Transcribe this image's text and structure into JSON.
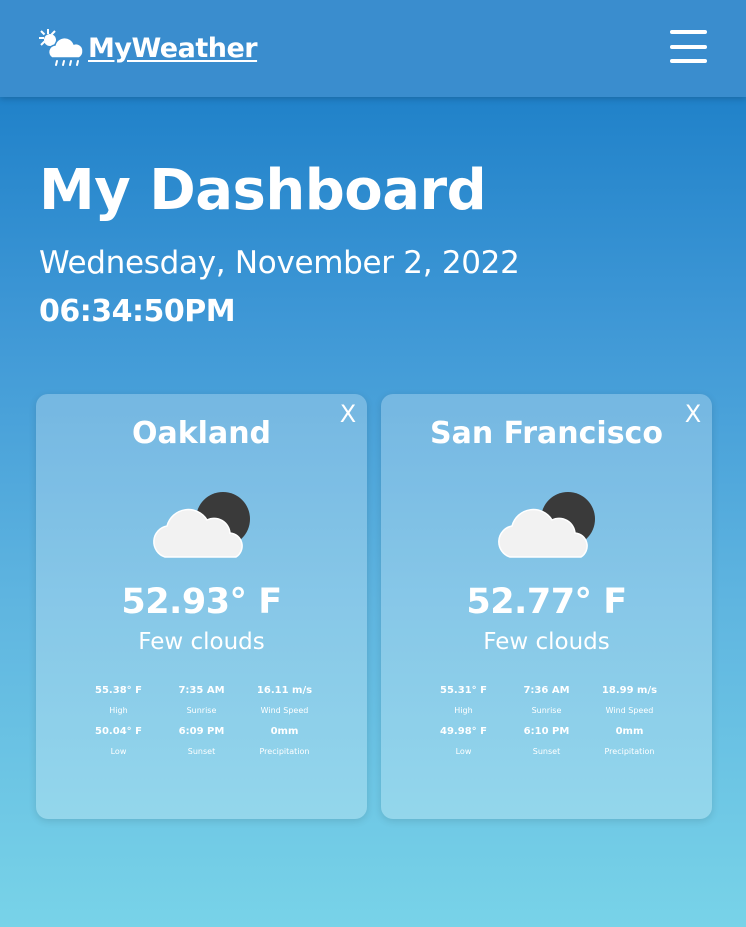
{
  "navbar": {
    "brand": "MyWeather",
    "logo_icon": "sun-cloud-rain-icon",
    "menu_icon": "hamburger-menu-icon"
  },
  "dashboard": {
    "title": "My Dashboard",
    "date": "Wednesday, November 2, 2022",
    "time": "06:34:50PM"
  },
  "cards": [
    {
      "city": "Oakland",
      "close": "X",
      "icon": "few-clouds-night-icon",
      "temp": "52.93° F",
      "description": "Few clouds",
      "stats": [
        {
          "value": "55.38° F",
          "label": "High"
        },
        {
          "value": "7:35 AM",
          "label": "Sunrise"
        },
        {
          "value": "16.11 m/s",
          "label": "Wind Speed"
        },
        {
          "value": "50.04° F",
          "label": "Low"
        },
        {
          "value": "6:09 PM",
          "label": "Sunset"
        },
        {
          "value": "0mm",
          "label": "Precipitation"
        }
      ]
    },
    {
      "city": "San Francisco",
      "close": "X",
      "icon": "few-clouds-night-icon",
      "temp": "52.77° F",
      "description": "Few clouds",
      "stats": [
        {
          "value": "55.31° F",
          "label": "High"
        },
        {
          "value": "7:36 AM",
          "label": "Sunrise"
        },
        {
          "value": "18.99 m/s",
          "label": "Wind Speed"
        },
        {
          "value": "49.98° F",
          "label": "Low"
        },
        {
          "value": "6:10 PM",
          "label": "Sunset"
        },
        {
          "value": "0mm",
          "label": "Precipitation"
        }
      ]
    }
  ],
  "colors": {
    "navbar": "#3a8dce",
    "gradient_top": "#1378c4",
    "gradient_bottom": "#78d3e8",
    "moon": "#3a3a3a",
    "cloud": "#f2f2f2"
  }
}
